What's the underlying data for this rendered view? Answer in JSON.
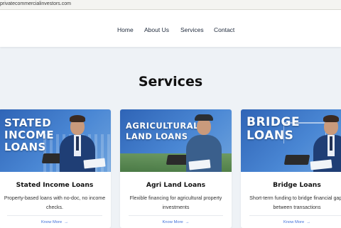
{
  "browser": {
    "url": "privatecommercialinvestors.com"
  },
  "nav": {
    "home": "Home",
    "about": "About Us",
    "services": "Services",
    "contact": "Contact"
  },
  "section_title": "Services",
  "cards": [
    {
      "banner_lines": [
        "STATED",
        "INCOME",
        "LOANS"
      ],
      "title": "Stated Income Loans",
      "description": "Property-based loans with no-doc, no income checks.",
      "cta": "Know More",
      "cta_icon": "arrow-right-icon"
    },
    {
      "banner_lines": [
        "AGRICULTURAL",
        "LAND LOANS"
      ],
      "title": "Agri Land Loans",
      "description": "Flexible financing for agricultural property investments",
      "cta": "Know More",
      "cta_icon": "arrow-right-icon"
    },
    {
      "banner_lines": [
        "BRIDGE",
        "LOANS"
      ],
      "title": "Bridge Loans",
      "description": "Short-term funding to bridge financial gaps between transactions",
      "cta": "Know More",
      "cta_icon": "arrow-right-icon"
    }
  ],
  "colors": {
    "banner_blue": "#3b74c6",
    "link_blue": "#3f6fd8",
    "background": "#eef2f6"
  }
}
